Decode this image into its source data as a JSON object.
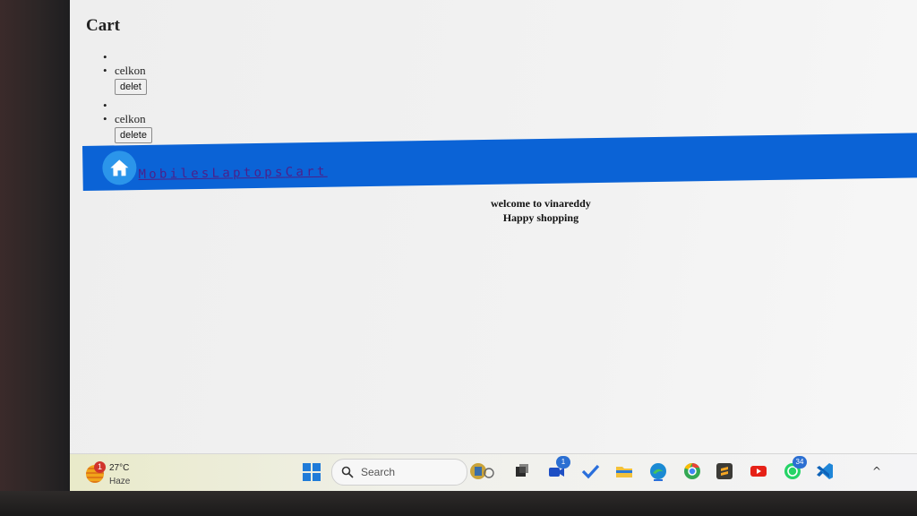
{
  "cart": {
    "heading": "Cart",
    "items": [
      {
        "name": "celkon",
        "delete_label": "delet"
      },
      {
        "name": "celkon",
        "delete_label": "delete"
      }
    ]
  },
  "nav": {
    "home_icon": "home-icon",
    "links": [
      "Mobiles",
      "Laptops",
      "Cart"
    ],
    "color": "#0b63d6"
  },
  "welcome": {
    "line1": "welcome to vinareddy",
    "line2": "Happy shopping"
  },
  "taskbar": {
    "weather": {
      "badge": "1",
      "temp": "27°C",
      "condition": "Haze"
    },
    "search_label": "Search",
    "badges": {
      "meet": "1",
      "whatsapp": "34"
    }
  }
}
